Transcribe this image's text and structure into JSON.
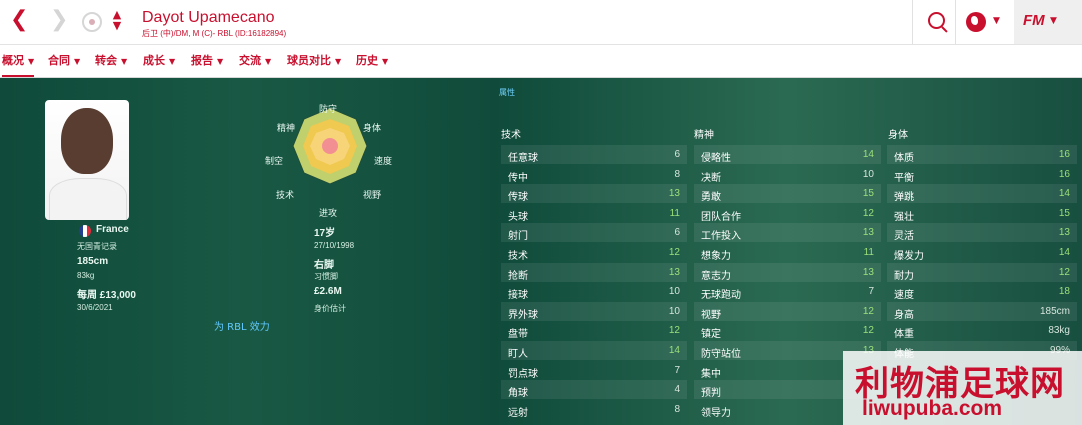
{
  "header": {
    "player_name": "Dayot Upamecano",
    "subtitle": "后卫 (中)/DM, M (C)- RBL (ID:16182894)",
    "fm_logo": "FM"
  },
  "tabs": [
    {
      "label": "概况"
    },
    {
      "label": "合同"
    },
    {
      "label": "转会"
    },
    {
      "label": "成长"
    },
    {
      "label": "报告"
    },
    {
      "label": "交流"
    },
    {
      "label": "球员对比"
    },
    {
      "label": "历史"
    }
  ],
  "profile": {
    "nationality": "France",
    "youth_record": "无国青记录",
    "height": "185cm",
    "weight": "83kg",
    "wage": "每周 £13,000",
    "contract_end": "30/6/2021",
    "age": "17岁",
    "birth_date": "27/10/1998",
    "preferred_foot": "右脚",
    "preferred_foot_label": "习惯脚",
    "value": "£2.6M",
    "value_label": "身价估计",
    "join_link": "为 RBL 效力"
  },
  "radar": {
    "labels": [
      "防守",
      "身体",
      "速度",
      "视野",
      "进攻",
      "技术",
      "制空",
      "精神"
    ]
  },
  "attributes_header": "属性",
  "section_titles": {
    "technical": "技术",
    "mental": "精神",
    "physical": "身体"
  },
  "technical": [
    {
      "name": "任意球",
      "value": "6"
    },
    {
      "name": "传中",
      "value": "8"
    },
    {
      "name": "传球",
      "value": "13"
    },
    {
      "name": "头球",
      "value": "11"
    },
    {
      "name": "射门",
      "value": "6"
    },
    {
      "name": "技术",
      "value": "12"
    },
    {
      "name": "抢断",
      "value": "13"
    },
    {
      "name": "接球",
      "value": "10"
    },
    {
      "name": "界外球",
      "value": "10"
    },
    {
      "name": "盘带",
      "value": "12"
    },
    {
      "name": "盯人",
      "value": "14"
    },
    {
      "name": "罚点球",
      "value": "7"
    },
    {
      "name": "角球",
      "value": "4"
    },
    {
      "name": "远射",
      "value": "8"
    }
  ],
  "mental": [
    {
      "name": "侵略性",
      "value": "14"
    },
    {
      "name": "决断",
      "value": "10"
    },
    {
      "name": "勇敢",
      "value": "15"
    },
    {
      "name": "团队合作",
      "value": "12"
    },
    {
      "name": "工作投入",
      "value": "13"
    },
    {
      "name": "想象力",
      "value": "11"
    },
    {
      "name": "意志力",
      "value": "13"
    },
    {
      "name": "无球跑动",
      "value": "7"
    },
    {
      "name": "视野",
      "value": "12"
    },
    {
      "name": "镇定",
      "value": "12"
    },
    {
      "name": "防守站位",
      "value": "13"
    },
    {
      "name": "集中",
      "value": ""
    },
    {
      "name": "预判",
      "value": ""
    },
    {
      "name": "领导力",
      "value": ""
    }
  ],
  "physical": [
    {
      "name": "体质",
      "value": "16"
    },
    {
      "name": "平衡",
      "value": "16"
    },
    {
      "name": "弹跳",
      "value": "14"
    },
    {
      "name": "强壮",
      "value": "15"
    },
    {
      "name": "灵活",
      "value": "13"
    },
    {
      "name": "爆发力",
      "value": "14"
    },
    {
      "name": "耐力",
      "value": "12"
    },
    {
      "name": "速度",
      "value": "18"
    },
    {
      "name": "身高",
      "value": "185cm"
    },
    {
      "name": "体重",
      "value": "83kg"
    },
    {
      "name": "体能",
      "value": "99%"
    }
  ],
  "watermark": {
    "cn": "利物浦足球网",
    "en": "liwupuba.com"
  },
  "colors": {
    "brand": "#c8102e",
    "panel_bg": "#0f4a3a",
    "value_green": "#9be07a",
    "value_gray": "#d6e6dd",
    "link": "#61c9ff"
  }
}
